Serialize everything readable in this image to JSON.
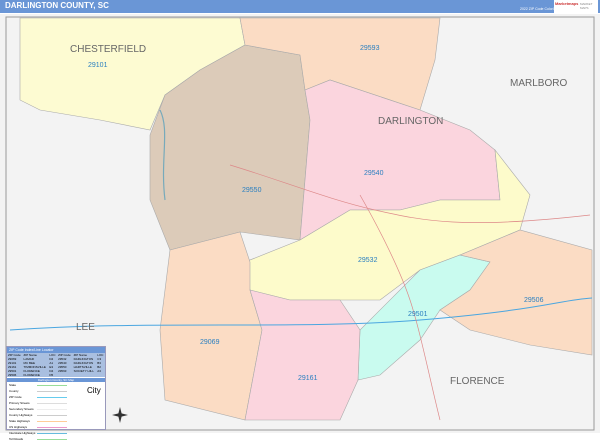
{
  "header": {
    "title": "DARLINGTON COUNTY, SC",
    "edition": "2022 ZIP Code ColorCast Edition",
    "logo_text": "Marketmaps",
    "logo_sub": "MARKET MAPS"
  },
  "map": {
    "counties": [
      {
        "name": "CHESTERFIELD"
      },
      {
        "name": "MARLBORO"
      },
      {
        "name": "DARLINGTON"
      },
      {
        "name": "LEE"
      },
      {
        "name": "FLORENCE"
      }
    ],
    "zip_areas": [
      {
        "zip": "29101",
        "color": "#fdfbd2"
      },
      {
        "zip": "29550",
        "color": "#dccbb9"
      },
      {
        "zip": "29593",
        "color": "#fbdcc4"
      },
      {
        "zip": "29540",
        "color": "#fbd5de"
      },
      {
        "zip": "29532",
        "color": "#fdfbcb"
      },
      {
        "zip": "29501",
        "color": "#c9fbef"
      },
      {
        "zip": "29506",
        "color": "#fbdcc4"
      },
      {
        "zip": "29069",
        "color": "#fbdcc4"
      },
      {
        "zip": "29161",
        "color": "#fbd5de"
      }
    ]
  },
  "legend": {
    "title": "ZIP Code Index/Line Locator",
    "columns": [
      "ZIP Code",
      "ZIP Name",
      "LOC"
    ],
    "rows": [
      [
        "29069",
        "LAMAR",
        "D4"
      ],
      [
        "29101",
        "MC BEE",
        "A1"
      ],
      [
        "29161",
        "TIMMONSVILLE",
        "E3"
      ],
      [
        "29501",
        "FLORENCE",
        "D4"
      ],
      [
        "29506",
        "FLORENCE",
        "D5"
      ],
      [
        "29532",
        "DARLINGTON",
        "C3"
      ],
      [
        "29540",
        "DARLINGTON",
        "B3"
      ],
      [
        "29550",
        "HARTSVILLE",
        "B2"
      ],
      [
        "29593",
        "SOCIETY HILL",
        "A3"
      ]
    ],
    "road_header": "Darlington County, SC Map",
    "items": [
      "State",
      "County",
      "ZIP Code",
      "Primary Streets",
      "Secondary Streets",
      "County Highways",
      "State Highways",
      "US Highways",
      "Interstate Highways",
      "Toll Roads"
    ],
    "city_label": "City"
  }
}
